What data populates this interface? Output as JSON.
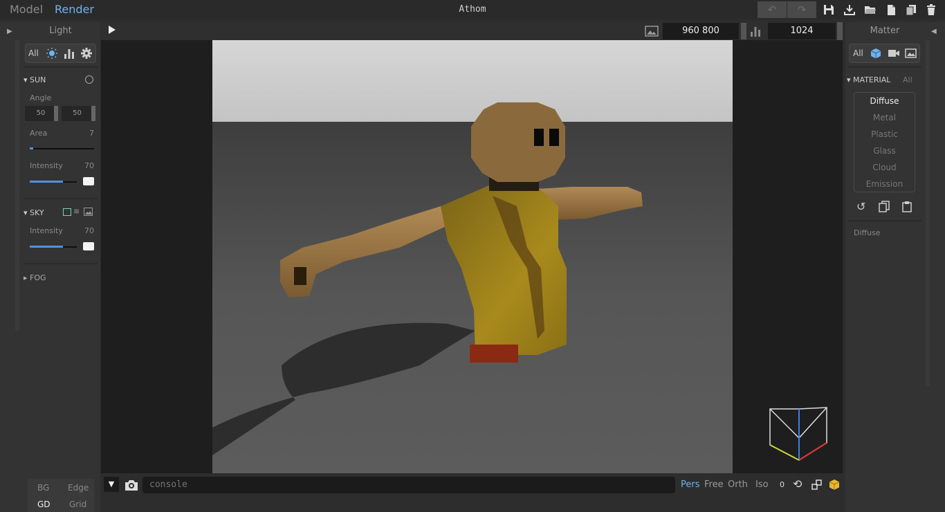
{
  "header": {
    "tabs": [
      {
        "label": "Model"
      },
      {
        "label": "Render"
      }
    ],
    "active_tab": "Render",
    "title": "Athom",
    "actions": [
      "undo-icon",
      "redo-icon",
      "save-icon",
      "import-icon",
      "open-folder-icon",
      "new-file-icon",
      "duplicate-icon",
      "delete-icon"
    ]
  },
  "left_panel": {
    "title": "Light",
    "filters": {
      "all_label": "All",
      "icons": [
        "sun-icon",
        "chart-icon",
        "gear-icon"
      ]
    },
    "sun": {
      "title": "SUN",
      "angle_label": "Angle",
      "angle_values": [
        "50",
        "50"
      ],
      "area_label": "Area",
      "area_value": "7",
      "area_fraction": 0.05,
      "intensity_label": "Intensity",
      "intensity_value": "70",
      "intensity_fraction": 0.7
    },
    "sky": {
      "title": "SKY",
      "intensity_label": "Intensity",
      "intensity_value": "70",
      "intensity_fraction": 0.7
    },
    "fog": {
      "title": "FOG"
    },
    "bottom_buttons": [
      {
        "label": "BG"
      },
      {
        "label": "Edge"
      },
      {
        "label": "GD"
      },
      {
        "label": "Grid"
      }
    ]
  },
  "viewport": {
    "resolution": "960  800",
    "samples": "1024"
  },
  "bottom_bar": {
    "console_placeholder": "console",
    "view_modes": [
      {
        "label": "Pers"
      },
      {
        "label": "Free"
      },
      {
        "label": "Orth"
      },
      {
        "label": "Iso"
      }
    ],
    "active_view": "Pers",
    "rotation_value": "0"
  },
  "right_panel": {
    "title": "Matter",
    "filters": {
      "all_label": "All",
      "icons": [
        "cube-icon",
        "camera-icon",
        "image-icon"
      ]
    },
    "material_title": "MATERIAL",
    "material_all": "All",
    "materials": [
      {
        "label": "Diffuse"
      },
      {
        "label": "Metal"
      },
      {
        "label": "Plastic"
      },
      {
        "label": "Glass"
      },
      {
        "label": "Cloud"
      },
      {
        "label": "Emission"
      }
    ],
    "selected_material": "Diffuse",
    "detail_label": "Diffuse"
  },
  "colors": {
    "accent": "#6fb3ef",
    "slider": "#4f93db",
    "panel": "#333333",
    "viewport_bg": "#1e1e1e"
  }
}
